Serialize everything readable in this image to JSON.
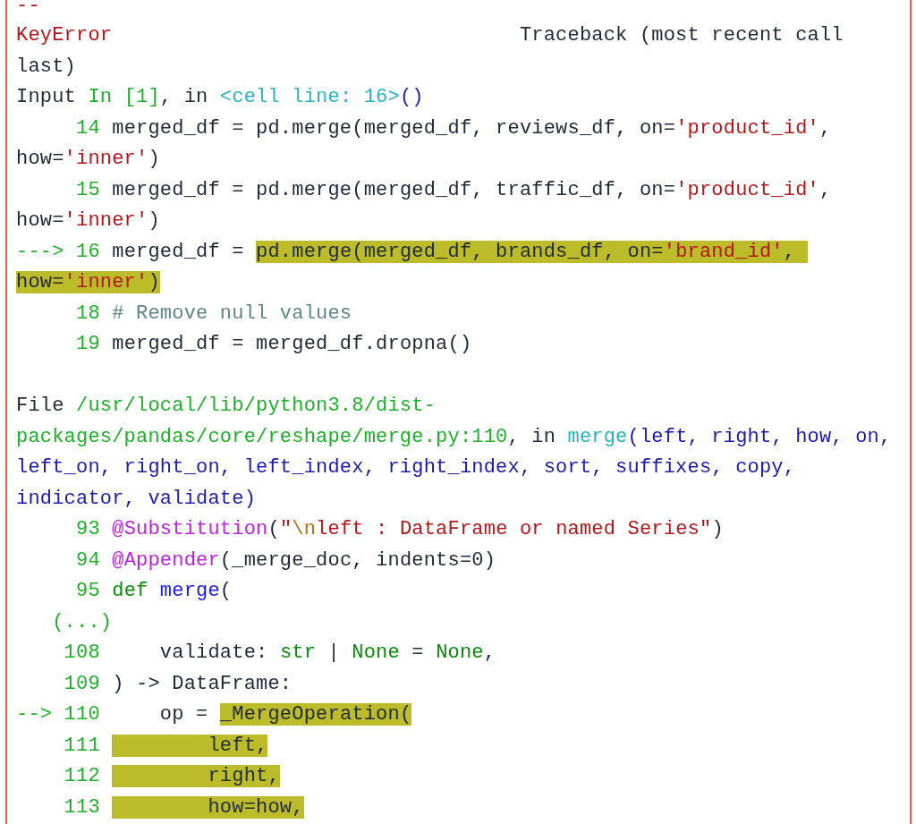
{
  "traceback": {
    "sections": [
      {
        "lines": [
          {
            "segments": [
              {
                "text": "--",
                "kind": "error",
                "highlight": false
              }
            ]
          },
          {
            "segments": [
              {
                "text": "KeyError",
                "kind": "error",
                "highlight": false
              },
              {
                "text": "                                  Traceback (most recent call",
                "kind": "plain",
                "highlight": false
              }
            ]
          },
          {
            "segments": [
              {
                "text": "last)",
                "kind": "plain",
                "highlight": false
              }
            ]
          },
          {
            "segments": [
              {
                "text": "Input ",
                "kind": "plain",
                "highlight": false
              },
              {
                "text": "In [1]",
                "kind": "path",
                "highlight": false
              },
              {
                "text": ", in ",
                "kind": "plain",
                "highlight": false
              },
              {
                "text": "<cell line: 16>",
                "kind": "cell",
                "highlight": false
              },
              {
                "text": "()",
                "kind": "args",
                "highlight": false
              }
            ]
          },
          {
            "segments": [
              {
                "text": "     14",
                "kind": "lineno",
                "highlight": false
              },
              {
                "text": " merged_df = pd.merge(merged_df, reviews_df, on=",
                "kind": "plain",
                "highlight": false
              },
              {
                "text": "'product_id'",
                "kind": "string",
                "highlight": false
              },
              {
                "text": ",",
                "kind": "plain",
                "highlight": false
              }
            ]
          },
          {
            "segments": [
              {
                "text": "how=",
                "kind": "plain",
                "highlight": false
              },
              {
                "text": "'inner'",
                "kind": "string",
                "highlight": false
              },
              {
                "text": ")",
                "kind": "plain",
                "highlight": false
              }
            ]
          },
          {
            "segments": [
              {
                "text": "     15",
                "kind": "lineno",
                "highlight": false
              },
              {
                "text": " merged_df = pd.merge(merged_df, traffic_df, on=",
                "kind": "plain",
                "highlight": false
              },
              {
                "text": "'product_id'",
                "kind": "string",
                "highlight": false
              },
              {
                "text": ",",
                "kind": "plain",
                "highlight": false
              }
            ]
          },
          {
            "segments": [
              {
                "text": "how=",
                "kind": "plain",
                "highlight": false
              },
              {
                "text": "'inner'",
                "kind": "string",
                "highlight": false
              },
              {
                "text": ")",
                "kind": "plain",
                "highlight": false
              }
            ]
          },
          {
            "segments": [
              {
                "text": "---> 16",
                "kind": "lineno",
                "highlight": false
              },
              {
                "text": " merged_df = ",
                "kind": "plain",
                "highlight": false
              },
              {
                "text": "pd.merge(merged_df, brands_df, on=",
                "kind": "plain",
                "highlight": true
              },
              {
                "text": "'brand_id'",
                "kind": "string",
                "highlight": true
              },
              {
                "text": ", ",
                "kind": "plain",
                "highlight": true
              }
            ]
          },
          {
            "segments": [
              {
                "text": "how=",
                "kind": "plain",
                "highlight": true
              },
              {
                "text": "'inner'",
                "kind": "string",
                "highlight": true
              },
              {
                "text": ")",
                "kind": "plain",
                "highlight": true
              }
            ]
          },
          {
            "segments": [
              {
                "text": "     18",
                "kind": "lineno",
                "highlight": false
              },
              {
                "text": " # Remove null values",
                "kind": "comment",
                "highlight": false
              }
            ]
          },
          {
            "segments": [
              {
                "text": "     19",
                "kind": "lineno",
                "highlight": false
              },
              {
                "text": " merged_df = merged_df.dropna()",
                "kind": "plain",
                "highlight": false
              }
            ]
          }
        ]
      },
      {
        "lines": [
          {
            "segments": [
              {
                "text": "File ",
                "kind": "plain",
                "highlight": false
              },
              {
                "text": "/usr/local/lib/python3.8/dist-",
                "kind": "path",
                "highlight": false
              }
            ]
          },
          {
            "segments": [
              {
                "text": "packages/pandas/core/reshape/merge.py:110",
                "kind": "path",
                "highlight": false
              },
              {
                "text": ", in ",
                "kind": "plain",
                "highlight": false
              },
              {
                "text": "merge",
                "kind": "cell",
                "highlight": false
              },
              {
                "text": "(left, right, how, on,",
                "kind": "args",
                "highlight": false
              }
            ]
          },
          {
            "segments": [
              {
                "text": "left_on, right_on, left_index, right_index, sort, suffixes, copy,",
                "kind": "args",
                "highlight": false
              }
            ]
          },
          {
            "segments": [
              {
                "text": "indicator, validate)",
                "kind": "args",
                "highlight": false
              }
            ]
          },
          {
            "segments": [
              {
                "text": "     93",
                "kind": "lineno",
                "highlight": false
              },
              {
                "text": " @Substitution",
                "kind": "decorator",
                "highlight": false
              },
              {
                "text": "(",
                "kind": "plain",
                "highlight": false
              },
              {
                "text": "\"",
                "kind": "string",
                "highlight": false
              },
              {
                "text": "\\n",
                "kind": "escape",
                "highlight": false
              },
              {
                "text": "left : DataFrame or named Series\"",
                "kind": "string",
                "highlight": false
              },
              {
                "text": ")",
                "kind": "plain",
                "highlight": false
              }
            ]
          },
          {
            "segments": [
              {
                "text": "     94",
                "kind": "lineno",
                "highlight": false
              },
              {
                "text": " @Appender",
                "kind": "decorator",
                "highlight": false
              },
              {
                "text": "(_merge_doc, indents=0)",
                "kind": "plain",
                "highlight": false
              }
            ]
          },
          {
            "segments": [
              {
                "text": "     95",
                "kind": "lineno",
                "highlight": false
              },
              {
                "text": " def",
                "kind": "keyword",
                "highlight": false
              },
              {
                "text": " merge",
                "kind": "funcname",
                "highlight": false
              },
              {
                "text": "(",
                "kind": "plain",
                "highlight": false
              }
            ]
          },
          {
            "segments": [
              {
                "text": "   (...)",
                "kind": "lineno",
                "highlight": false
              }
            ]
          },
          {
            "segments": [
              {
                "text": "    108",
                "kind": "lineno",
                "highlight": false
              },
              {
                "text": "     validate: ",
                "kind": "plain",
                "highlight": false
              },
              {
                "text": "str",
                "kind": "builtin",
                "highlight": false
              },
              {
                "text": " | ",
                "kind": "plain",
                "highlight": false
              },
              {
                "text": "None",
                "kind": "builtin",
                "highlight": false
              },
              {
                "text": " = ",
                "kind": "plain",
                "highlight": false
              },
              {
                "text": "None",
                "kind": "builtin",
                "highlight": false
              },
              {
                "text": ",",
                "kind": "plain",
                "highlight": false
              }
            ]
          },
          {
            "segments": [
              {
                "text": "    109",
                "kind": "lineno",
                "highlight": false
              },
              {
                "text": " ) -> DataFrame:",
                "kind": "plain",
                "highlight": false
              }
            ]
          },
          {
            "segments": [
              {
                "text": "--> 110",
                "kind": "lineno",
                "highlight": false
              },
              {
                "text": "     op = ",
                "kind": "plain",
                "highlight": false
              },
              {
                "text": "_MergeOperation(",
                "kind": "plain",
                "highlight": true
              }
            ]
          },
          {
            "segments": [
              {
                "text": "    111 ",
                "kind": "lineno",
                "highlight": false
              },
              {
                "text": "        left,",
                "kind": "plain",
                "highlight": true
              }
            ]
          },
          {
            "segments": [
              {
                "text": "    112 ",
                "kind": "lineno",
                "highlight": false
              },
              {
                "text": "        right,",
                "kind": "plain",
                "highlight": true
              }
            ]
          },
          {
            "segments": [
              {
                "text": "    113 ",
                "kind": "lineno",
                "highlight": false
              },
              {
                "text": "        how=how,",
                "kind": "plain",
                "highlight": true
              }
            ]
          }
        ]
      }
    ]
  }
}
